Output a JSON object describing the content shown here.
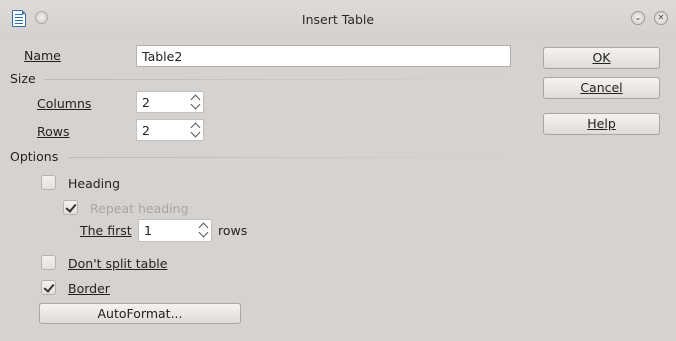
{
  "window": {
    "title": "Insert Table"
  },
  "name": {
    "label": "Name",
    "value": "Table2"
  },
  "size": {
    "heading": "Size",
    "columns": {
      "label": "Columns",
      "value": "2"
    },
    "rows": {
      "label": "Rows",
      "value": "2"
    }
  },
  "options": {
    "heading": "Options",
    "heading_check": {
      "label": "Heading",
      "checked": false
    },
    "repeat_heading": {
      "label": "Repeat heading",
      "checked": true,
      "enabled": false
    },
    "the_first": {
      "label": "The first",
      "value": "1",
      "suffix": "rows"
    },
    "dont_split": {
      "label": "Don't split table",
      "checked": false
    },
    "border": {
      "label": "Border",
      "checked": true
    },
    "autoformat_label": "AutoFormat..."
  },
  "buttons": {
    "ok": "OK",
    "cancel": "Cancel",
    "help": "Help"
  },
  "icons": [
    "document-icon",
    "window-menu-icon",
    "minimize-icon",
    "close-icon",
    "spin-up-icon",
    "spin-down-icon",
    "checkmark-icon"
  ]
}
